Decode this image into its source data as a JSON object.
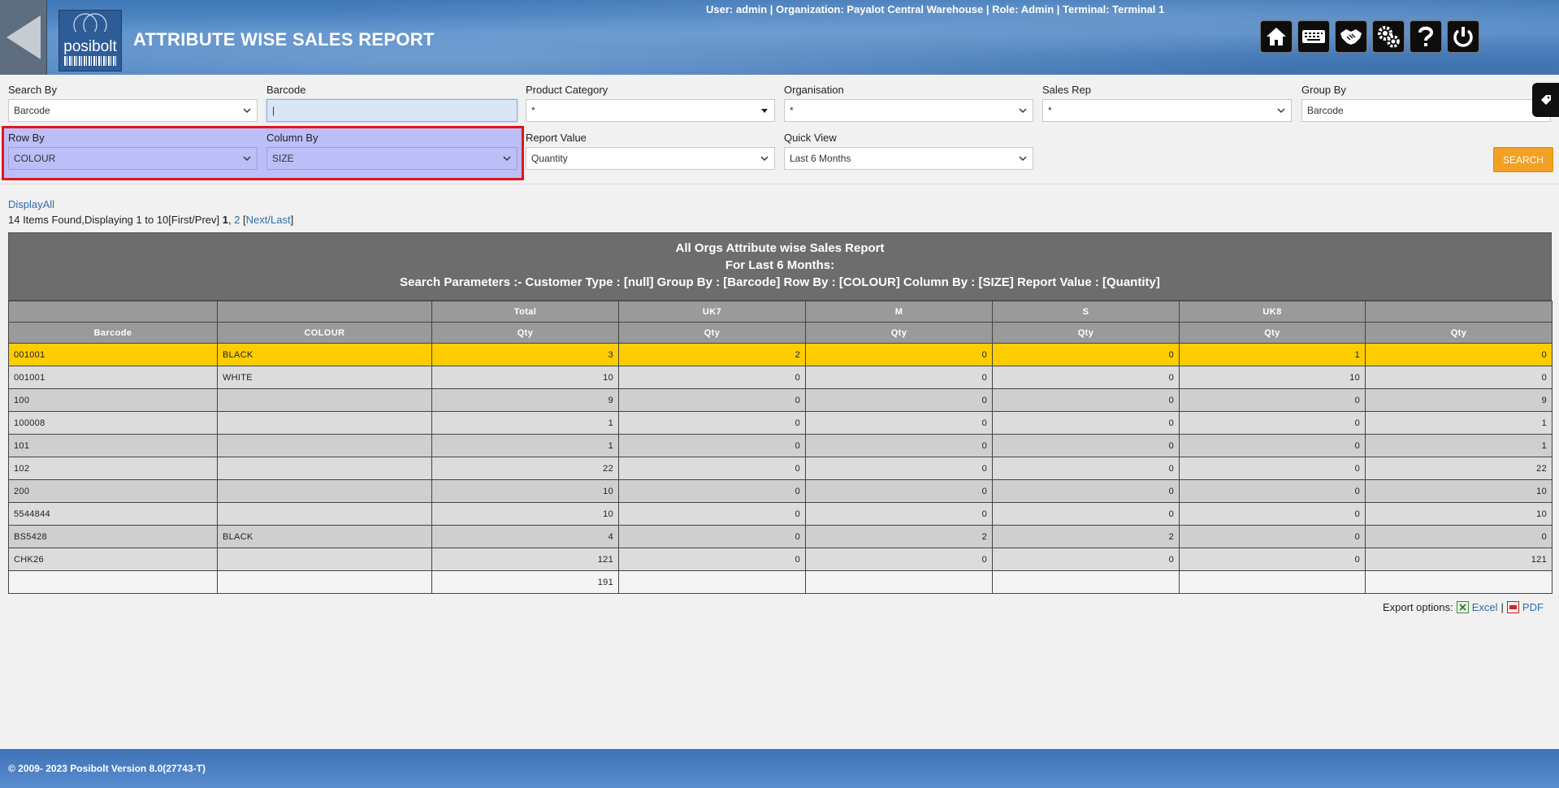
{
  "header": {
    "title": "ATTRIBUTE WISE SALES REPORT",
    "logo_text": "posibolt",
    "user_info": "User: admin | Organization: Payalot Central Warehouse | Role: Admin | Terminal: Terminal 1",
    "icons": [
      "home-icon",
      "keyboard-icon",
      "handshake-icon",
      "settings-icon",
      "help-icon",
      "power-icon"
    ]
  },
  "filters": {
    "search_by": {
      "label": "Search By",
      "value": "Barcode"
    },
    "barcode": {
      "label": "Barcode",
      "value": "|"
    },
    "product_category": {
      "label": "Product Category",
      "value": "*"
    },
    "organisation": {
      "label": "Organisation",
      "value": "*"
    },
    "sales_rep": {
      "label": "Sales Rep",
      "value": "*"
    },
    "group_by": {
      "label": "Group By",
      "value": "Barcode"
    },
    "row_by": {
      "label": "Row By",
      "value": "COLOUR"
    },
    "column_by": {
      "label": "Column By",
      "value": "SIZE"
    },
    "report_value": {
      "label": "Report Value",
      "value": "Quantity"
    },
    "quick_view": {
      "label": "Quick View",
      "value": "Last 6 Months"
    },
    "search_label": "SEARCH"
  },
  "pager": {
    "display_all": "DisplayAll",
    "summary": "14 Items Found,Displaying 1 to 10[First/Prev] ",
    "current": "1",
    "sep": ", ",
    "page2": "2",
    "next_open": " [",
    "next_last": "Next/Last",
    "next_close": "]"
  },
  "report": {
    "title": "All Orgs Attribute wise Sales Report",
    "subtitle": "For Last 6 Months:",
    "params": "Search Parameters :- Customer Type : [null] Group By : [Barcode] Row By : [COLOUR] Column By : [SIZE] Report Value : [Quantity]",
    "group_headers": [
      "",
      "",
      "Total",
      "UK7",
      "M",
      "S",
      "UK8",
      ""
    ],
    "sub_headers": [
      "Barcode",
      "COLOUR",
      "Qty",
      "Qty",
      "Qty",
      "Qty",
      "Qty",
      "Qty"
    ],
    "rows": [
      {
        "barcode": "001001",
        "colour": "BLACK",
        "vals": [
          "3",
          "2",
          "0",
          "0",
          "1",
          "0"
        ]
      },
      {
        "barcode": "001001",
        "colour": "WHITE",
        "vals": [
          "10",
          "0",
          "0",
          "0",
          "10",
          "0"
        ]
      },
      {
        "barcode": "100",
        "colour": "",
        "vals": [
          "9",
          "0",
          "0",
          "0",
          "0",
          "9"
        ]
      },
      {
        "barcode": "100008",
        "colour": "",
        "vals": [
          "1",
          "0",
          "0",
          "0",
          "0",
          "1"
        ]
      },
      {
        "barcode": "101",
        "colour": "",
        "vals": [
          "1",
          "0",
          "0",
          "0",
          "0",
          "1"
        ]
      },
      {
        "barcode": "102",
        "colour": "",
        "vals": [
          "22",
          "0",
          "0",
          "0",
          "0",
          "22"
        ]
      },
      {
        "barcode": "200",
        "colour": "",
        "vals": [
          "10",
          "0",
          "0",
          "0",
          "0",
          "10"
        ]
      },
      {
        "barcode": "5544844",
        "colour": "",
        "vals": [
          "10",
          "0",
          "0",
          "0",
          "0",
          "10"
        ]
      },
      {
        "barcode": "BS5428",
        "colour": "BLACK",
        "vals": [
          "4",
          "0",
          "2",
          "2",
          "0",
          "0"
        ]
      },
      {
        "barcode": "CHK26",
        "colour": "",
        "vals": [
          "121",
          "0",
          "0",
          "0",
          "0",
          "121"
        ]
      }
    ],
    "total_row": [
      "",
      "",
      "191",
      "",
      "",
      "",
      "",
      ""
    ]
  },
  "export": {
    "label": "Export options:",
    "excel": "Excel",
    "sep": "|",
    "pdf": "PDF"
  },
  "footer": {
    "text": "© 2009- 2023 Posibolt Version  8.0(27743-T)"
  },
  "colors": {
    "highlight_row": "#ffcc00",
    "accent_button": "#f2a124",
    "header_blue": "#4a82c0",
    "selection_border": "#e2151f",
    "selection_fill": "#bbbef7"
  }
}
